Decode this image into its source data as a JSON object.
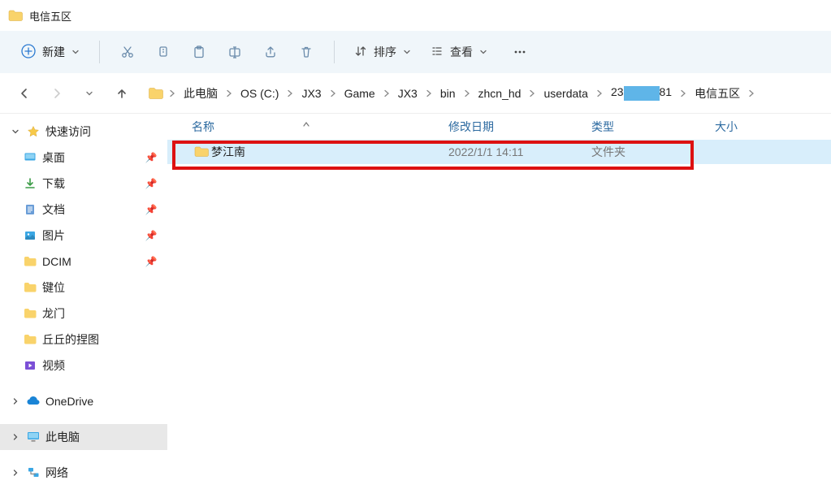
{
  "window": {
    "title": "电信五区"
  },
  "toolbar": {
    "new_label": "新建",
    "sort_label": "排序",
    "view_label": "查看"
  },
  "breadcrumb": {
    "items": [
      "此电脑",
      "OS (C:)",
      "JX3",
      "Game",
      "JX3",
      "bin",
      "zhcn_hd",
      "userdata"
    ],
    "censored_prefix": "23",
    "censored_suffix": "81",
    "tail": "电信五区"
  },
  "sidebar": {
    "quick_access": "快速访问",
    "pinned": [
      {
        "label": "桌面",
        "icon": "desktop"
      },
      {
        "label": "下载",
        "icon": "download"
      },
      {
        "label": "文档",
        "icon": "document"
      },
      {
        "label": "图片",
        "icon": "picture"
      },
      {
        "label": "DCIM",
        "icon": "folder"
      },
      {
        "label": "键位",
        "icon": "folder"
      },
      {
        "label": "龙门",
        "icon": "folder"
      },
      {
        "label": "丘丘的捏图",
        "icon": "folder"
      },
      {
        "label": "视频",
        "icon": "video"
      }
    ],
    "onedrive": "OneDrive",
    "this_pc": "此电脑",
    "network": "网络"
  },
  "columns": {
    "name": "名称",
    "date": "修改日期",
    "type": "类型",
    "size": "大小"
  },
  "files": [
    {
      "name": "梦江南",
      "date": "2022/1/1 14:11",
      "type": "文件夹",
      "size": ""
    }
  ]
}
